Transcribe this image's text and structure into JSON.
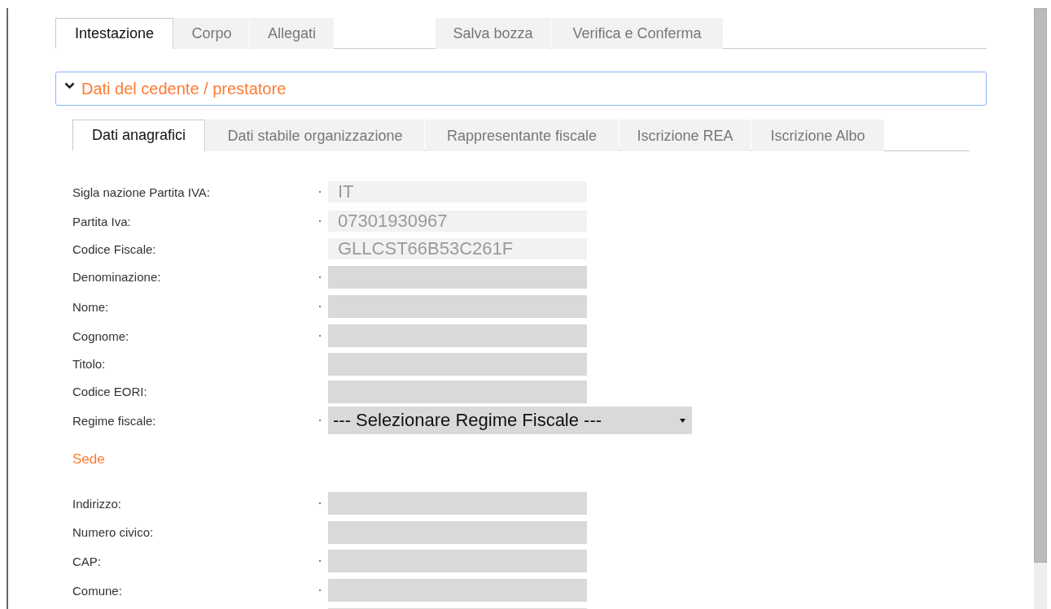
{
  "tabs": [
    {
      "label": "Intestazione",
      "selected": true
    },
    {
      "label": "Corpo",
      "selected": false
    },
    {
      "label": "Allegati",
      "selected": false
    }
  ],
  "actions": [
    {
      "label": "Salva bozza"
    },
    {
      "label": "Verifica e Conferma"
    }
  ],
  "section": {
    "title": "Dati del cedente / prestatore",
    "expanded": true
  },
  "subtabs": [
    {
      "label": "Dati anagrafici",
      "selected": true
    },
    {
      "label": "Dati stabile organizzazione",
      "selected": false
    },
    {
      "label": "Rappresentante fiscale",
      "selected": false
    },
    {
      "label": "Iscrizione REA",
      "selected": false
    },
    {
      "label": "Iscrizione Albo",
      "selected": false
    }
  ],
  "fields": [
    {
      "kind": "text",
      "label": "Sigla nazione Partita IVA:",
      "required": true,
      "disabled": true,
      "value": "IT"
    },
    {
      "kind": "text",
      "label": "Partita Iva:",
      "required": true,
      "disabled": true,
      "value": "07301930967"
    },
    {
      "kind": "text",
      "label": "Codice Fiscale:",
      "required": false,
      "disabled": true,
      "value": "GLLCST66B53C261F"
    },
    {
      "kind": "text",
      "label": "Denominazione:",
      "required": true,
      "disabled": false
    },
    {
      "kind": "text",
      "label": "Nome:",
      "required": true,
      "disabled": false
    },
    {
      "kind": "text",
      "label": "Cognome:",
      "required": true,
      "disabled": false
    },
    {
      "kind": "text",
      "label": "Titolo:",
      "required": false,
      "disabled": false
    },
    {
      "kind": "text",
      "label": "Codice EORI:",
      "required": false,
      "disabled": false
    },
    {
      "kind": "select",
      "label": "Regime fiscale:",
      "required": true,
      "disabled": false,
      "value": "--- Selezionare Regime Fiscale ---"
    }
  ],
  "address": {
    "title": "Sede",
    "fields": [
      {
        "kind": "text",
        "label": "Indirizzo:",
        "required": true,
        "disabled": false
      },
      {
        "kind": "text",
        "label": "Numero civico:",
        "required": false,
        "disabled": false
      },
      {
        "kind": "text",
        "label": "CAP:",
        "required": true,
        "disabled": false
      },
      {
        "kind": "text",
        "label": "Comune:",
        "required": true,
        "disabled": false
      },
      {
        "kind": "text",
        "required": false,
        "disabled": false
      }
    ]
  }
}
